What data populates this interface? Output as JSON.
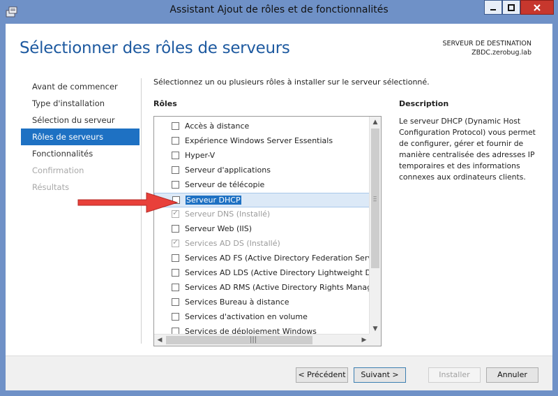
{
  "window": {
    "title": "Assistant Ajout de rôles et de fonctionnalités",
    "icon": "server-manager-icon",
    "controls": {
      "minimize": "minimize-icon",
      "maximize": "maximize-icon",
      "close": "close-icon"
    }
  },
  "header": {
    "page_title": "Sélectionner des rôles de serveurs",
    "destination_label": "SERVEUR DE DESTINATION",
    "destination_server": "ZBDC.zerobug.lab"
  },
  "nav": {
    "items": [
      {
        "label": "Avant de commencer",
        "state": "normal"
      },
      {
        "label": "Type d'installation",
        "state": "normal"
      },
      {
        "label": "Sélection du serveur",
        "state": "normal"
      },
      {
        "label": "Rôles de serveurs",
        "state": "active"
      },
      {
        "label": "Fonctionnalités",
        "state": "normal"
      },
      {
        "label": "Confirmation",
        "state": "disabled"
      },
      {
        "label": "Résultats",
        "state": "disabled"
      }
    ]
  },
  "main": {
    "intro": "Sélectionnez un ou plusieurs rôles à installer sur le serveur sélectionné.",
    "roles_label": "Rôles",
    "roles": [
      {
        "label": "Accès à distance",
        "checked": false,
        "disabled": false
      },
      {
        "label": "Expérience Windows Server Essentials",
        "checked": false,
        "disabled": false
      },
      {
        "label": "Hyper-V",
        "checked": false,
        "disabled": false
      },
      {
        "label": "Serveur d'applications",
        "checked": false,
        "disabled": false
      },
      {
        "label": "Serveur de télécopie",
        "checked": false,
        "disabled": false
      },
      {
        "label": "Serveur DHCP",
        "checked": false,
        "disabled": false,
        "selected": true
      },
      {
        "label": "Serveur DNS (Installé)",
        "checked": true,
        "disabled": true
      },
      {
        "label": "Serveur Web (IIS)",
        "checked": false,
        "disabled": false
      },
      {
        "label": "Services AD DS (Installé)",
        "checked": true,
        "disabled": true
      },
      {
        "label": "Services AD FS (Active Directory Federation Services)",
        "checked": false,
        "disabled": false
      },
      {
        "label": "Services AD LDS (Active Directory Lightweight Directory Services)",
        "checked": false,
        "disabled": false
      },
      {
        "label": "Services AD RMS (Active Directory Rights Management Services)",
        "checked": false,
        "disabled": false
      },
      {
        "label": "Services Bureau à distance",
        "checked": false,
        "disabled": false
      },
      {
        "label": "Services d'activation en volume",
        "checked": false,
        "disabled": false
      },
      {
        "label": "Services de déploiement Windows",
        "checked": false,
        "disabled": false
      }
    ],
    "description_label": "Description",
    "description_text": "Le serveur DHCP (Dynamic Host Configuration Protocol) vous permet de configurer, gérer et fournir de manière centralisée des adresses IP temporaires et des informations connexes aux ordinateurs clients."
  },
  "footer": {
    "previous": "< Précédent",
    "next": "Suivant >",
    "install": "Installer",
    "cancel": "Annuler"
  },
  "annotation": {
    "icon": "red-arrow-icon",
    "color": "#e8403a"
  }
}
